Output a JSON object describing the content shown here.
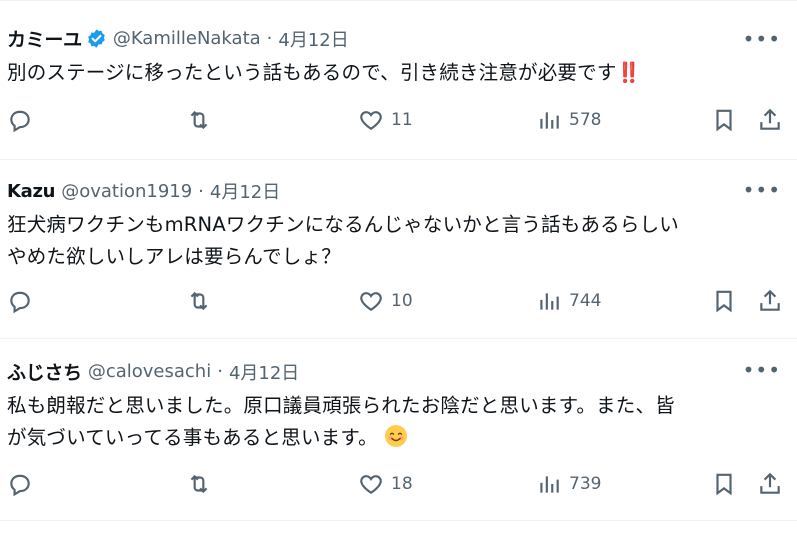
{
  "tweets": [
    {
      "name": "カミーユ",
      "verified": true,
      "handle": "@KamilleNakata",
      "sep": "·",
      "date": "4月12日",
      "lines": [
        "別のステージに移ったという話もあるので、引き続き注意が必要です"
      ],
      "trailing_emoji": "‼️",
      "replies": "",
      "retweets": "",
      "likes": "11",
      "views": "578"
    },
    {
      "name": "Kazu",
      "verified": false,
      "handle": "@ovation1919",
      "sep": "·",
      "date": "4月12日",
      "lines": [
        "狂犬病ワクチンもmRNAワクチンになるんじゃないかと言う話もあるらしい",
        "やめた欲しいしアレは要らんでしょ？"
      ],
      "replies": "",
      "retweets": "",
      "likes": "10",
      "views": "744"
    },
    {
      "name": "ふじさち",
      "verified": false,
      "handle": "@calovesachi",
      "sep": "·",
      "date": "4月12日",
      "lines": [
        "私も朗報だと思いました。原口議員頑張られたお陰だと思います。また、皆",
        "が気づいていってる事もあると思います。"
      ],
      "trailing_emoji": "😊",
      "replies": "",
      "retweets": "",
      "likes": "18",
      "views": "739"
    }
  ],
  "icons": {
    "more": "more-horizontal-icon",
    "reply": "reply-icon",
    "retweet": "retweet-icon",
    "like": "heart-icon",
    "views": "views-icon",
    "bookmark": "bookmark-icon",
    "share": "share-icon",
    "verified": "verified-badge-icon"
  },
  "colors": {
    "text": "#0f1419",
    "secondary": "#536471",
    "verified_blue": "#1d9bf0",
    "divider": "#eff3f4"
  }
}
